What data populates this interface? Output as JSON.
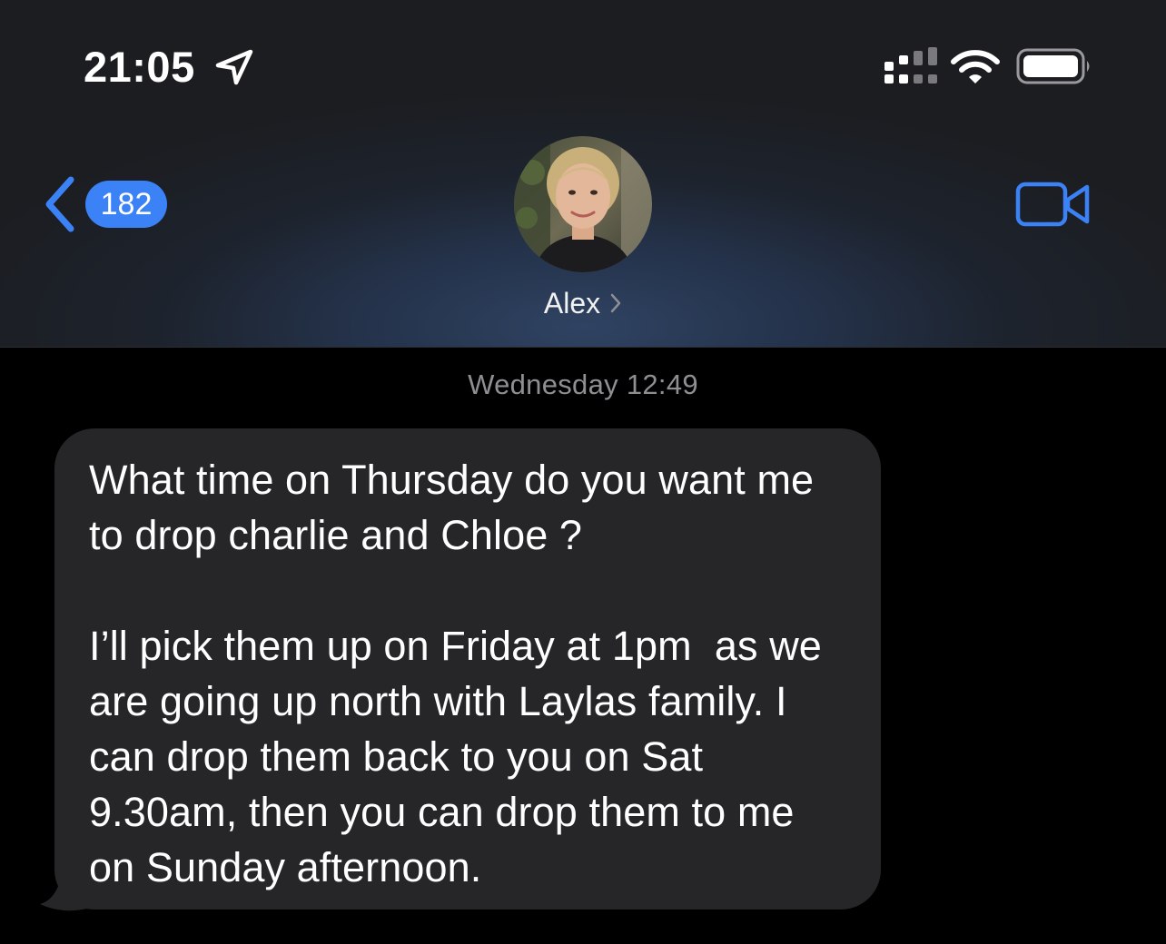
{
  "status_bar": {
    "time": "21:05",
    "icons": [
      "location-arrow-icon",
      "cellular-signal-icon",
      "wifi-icon",
      "battery-icon"
    ]
  },
  "nav": {
    "back_badge": "182",
    "contact_name": "Alex",
    "icons": [
      "back-chevron-icon",
      "chevron-right-icon",
      "video-camera-icon"
    ]
  },
  "conversation": {
    "timestamp": "Wednesday 12:49",
    "message": {
      "paragraph_1": "What time on Thursday do you want me to drop charlie and Chloe ?",
      "paragraph_2": "I’ll pick them up on Friday at 1pm  as we are going up north with Laylas family. I can drop them back to you on Sat 9.30am, then you can drop them to me on Sunday afternoon."
    }
  },
  "colors": {
    "accent_blue": "#3b82f6",
    "bubble_gray": "#262629",
    "timestamp_gray": "#8e8e93"
  }
}
